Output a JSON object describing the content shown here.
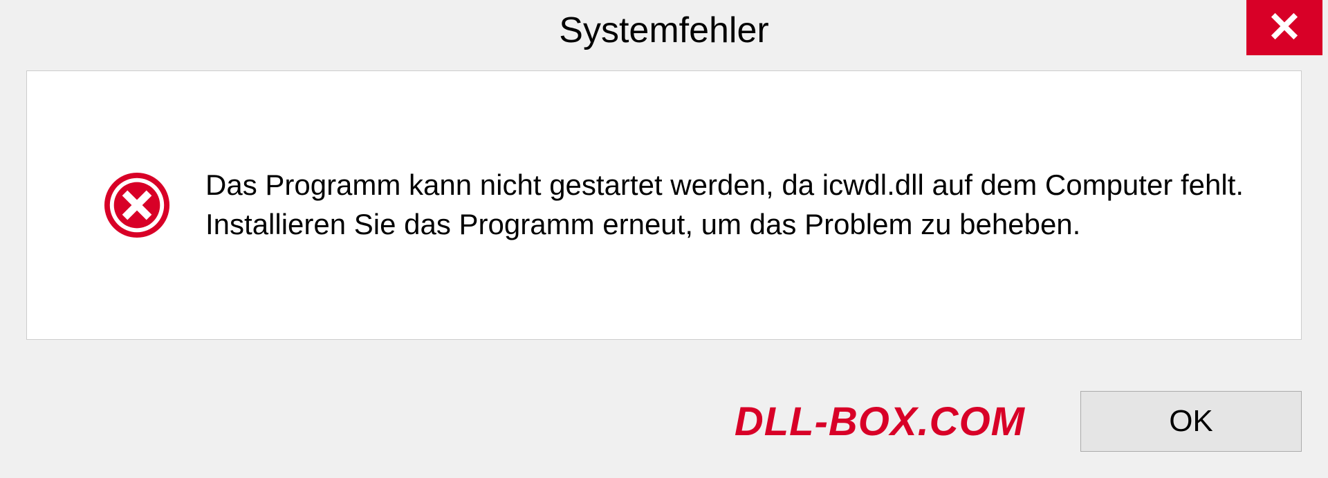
{
  "dialog": {
    "title": "Systemfehler",
    "message": "Das Programm kann nicht gestartet werden, da icwdl.dll auf dem Computer fehlt. Installieren Sie das Programm erneut, um das Problem zu beheben.",
    "ok_label": "OK"
  },
  "watermark": "DLL-BOX.COM",
  "colors": {
    "error_red": "#d80027",
    "panel_bg": "#ffffff",
    "dialog_bg": "#f0f0f0"
  }
}
